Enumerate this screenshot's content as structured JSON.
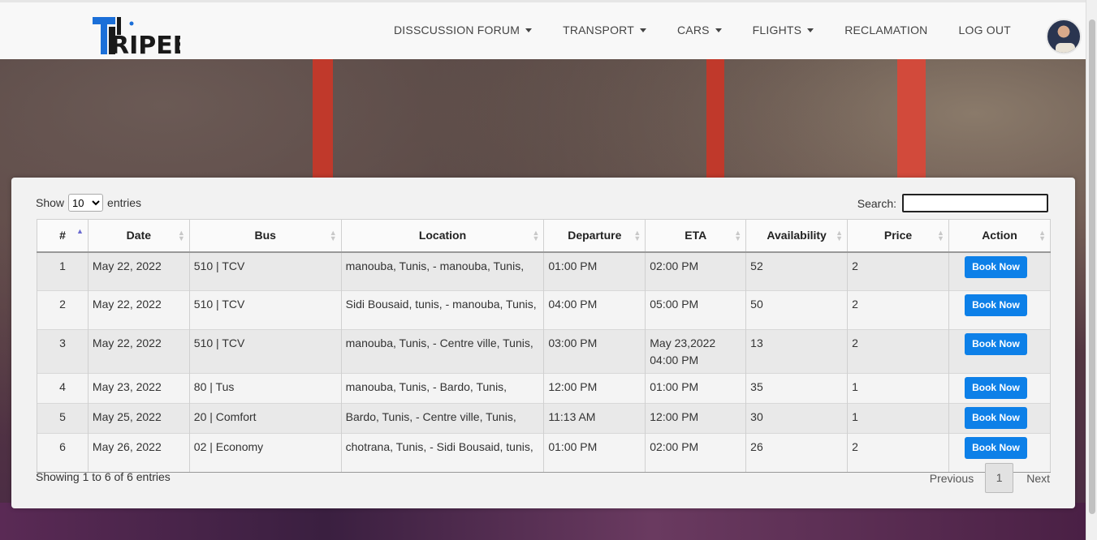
{
  "brand": {
    "logo_text": "RIPEE"
  },
  "nav": {
    "items": [
      {
        "label": "DISSCUSSION FORUM",
        "dropdown": true
      },
      {
        "label": "TRANSPORT",
        "dropdown": true
      },
      {
        "label": "CARS",
        "dropdown": true
      },
      {
        "label": "FLIGHTS",
        "dropdown": true
      },
      {
        "label": "RECLAMATION",
        "dropdown": false
      },
      {
        "label": "LOG OUT",
        "dropdown": false
      }
    ]
  },
  "controls": {
    "show_label": "Show",
    "entries_value": "10",
    "entries_label": "entries",
    "search_label": "Search:",
    "search_value": ""
  },
  "table": {
    "headers": [
      "#",
      "Date",
      "Bus",
      "Location",
      "Departure",
      "ETA",
      "Availability",
      "Price",
      "Action"
    ],
    "rows": [
      {
        "num": "1",
        "date": "May 22, 2022",
        "bus": "510 | TCV",
        "location": "manouba, Tunis, - manouba, Tunis,",
        "departure": "01:00 PM",
        "eta": "02:00 PM",
        "availability": "52",
        "price": "2",
        "action": "Book Now"
      },
      {
        "num": "2",
        "date": "May 22, 2022",
        "bus": "510 | TCV",
        "location": "Sidi Bousaid, tunis, - manouba, Tunis,",
        "departure": "04:00 PM",
        "eta": "05:00 PM",
        "availability": "50",
        "price": "2",
        "action": "Book Now"
      },
      {
        "num": "3",
        "date": "May 22, 2022",
        "bus": "510 | TCV",
        "location": "manouba, Tunis, - Centre ville, Tunis,",
        "departure": "03:00 PM",
        "eta": "May 23,2022 04:00 PM",
        "availability": "13",
        "price": "2",
        "action": "Book Now"
      },
      {
        "num": "4",
        "date": "May 23, 2022",
        "bus": "80 | Tus",
        "location": "manouba, Tunis, - Bardo, Tunis,",
        "departure": "12:00 PM",
        "eta": "01:00 PM",
        "availability": "35",
        "price": "1",
        "action": "Book Now"
      },
      {
        "num": "5",
        "date": "May 25, 2022",
        "bus": "20 | Comfort",
        "location": "Bardo, Tunis, - Centre ville, Tunis,",
        "departure": "11:13 AM",
        "eta": "12:00 PM",
        "availability": "30",
        "price": "1",
        "action": "Book Now"
      },
      {
        "num": "6",
        "date": "May 26, 2022",
        "bus": "02 | Economy",
        "location": "chotrana, Tunis, - Sidi Bousaid, tunis,",
        "departure": "01:00 PM",
        "eta": "02:00 PM",
        "availability": "26",
        "price": "2",
        "action": "Book Now"
      }
    ]
  },
  "footer": {
    "info": "Showing 1 to 6 of 6 entries",
    "previous": "Previous",
    "page": "1",
    "next": "Next"
  },
  "colors": {
    "accent": "#0d80e8",
    "logo_blue": "#1b6fd8",
    "logo_dark": "#1a1a1a"
  }
}
